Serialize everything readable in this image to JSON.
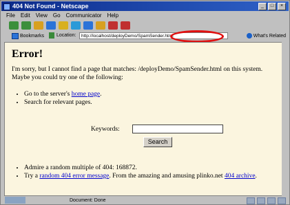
{
  "window": {
    "title": "404 Not Found - Netscape"
  },
  "menubar": {
    "items": [
      "File",
      "Edit",
      "View",
      "Go",
      "Communicator",
      "Help"
    ]
  },
  "toolbar": {
    "icons": [
      "back-icon",
      "forward-icon",
      "reload-icon",
      "home-icon",
      "search-icon",
      "netscape-icon",
      "print-icon",
      "security-icon",
      "shop-icon",
      "stop-icon"
    ]
  },
  "location_bar": {
    "bookmarks_label": "Bookmarks",
    "location_label": "Location:",
    "url": "http://localhost/deployDemo/SpamSender.html",
    "related_label": "What's Related"
  },
  "page": {
    "heading": "Error!",
    "message": "I'm sorry, but I cannot find a page that matches: /deployDemo/SpamSender.html on this system. Maybe you could try one of the following:",
    "suggestions": {
      "item1_prefix": "Go to the server's ",
      "item1_link": "home page",
      "item1_suffix": ".",
      "item2": "Search for relevant pages."
    },
    "search": {
      "keywords_label": "Keywords:",
      "keywords_value": "",
      "button_label": "Search"
    },
    "extras": {
      "item1": "Admire a random multiple of 404: 168872.",
      "item2_prefix": "Try a ",
      "item2_link1": "random 404 error message",
      "item2_middle": ". From the amazing and amusing plinko.net ",
      "item2_link2": "404 archive",
      "item2_suffix": "."
    }
  },
  "statusbar": {
    "text": "Document: Done"
  },
  "colors": {
    "highlight_ellipse": "#e01010",
    "page_background": "#fbf5df",
    "link": "#0000cc"
  }
}
